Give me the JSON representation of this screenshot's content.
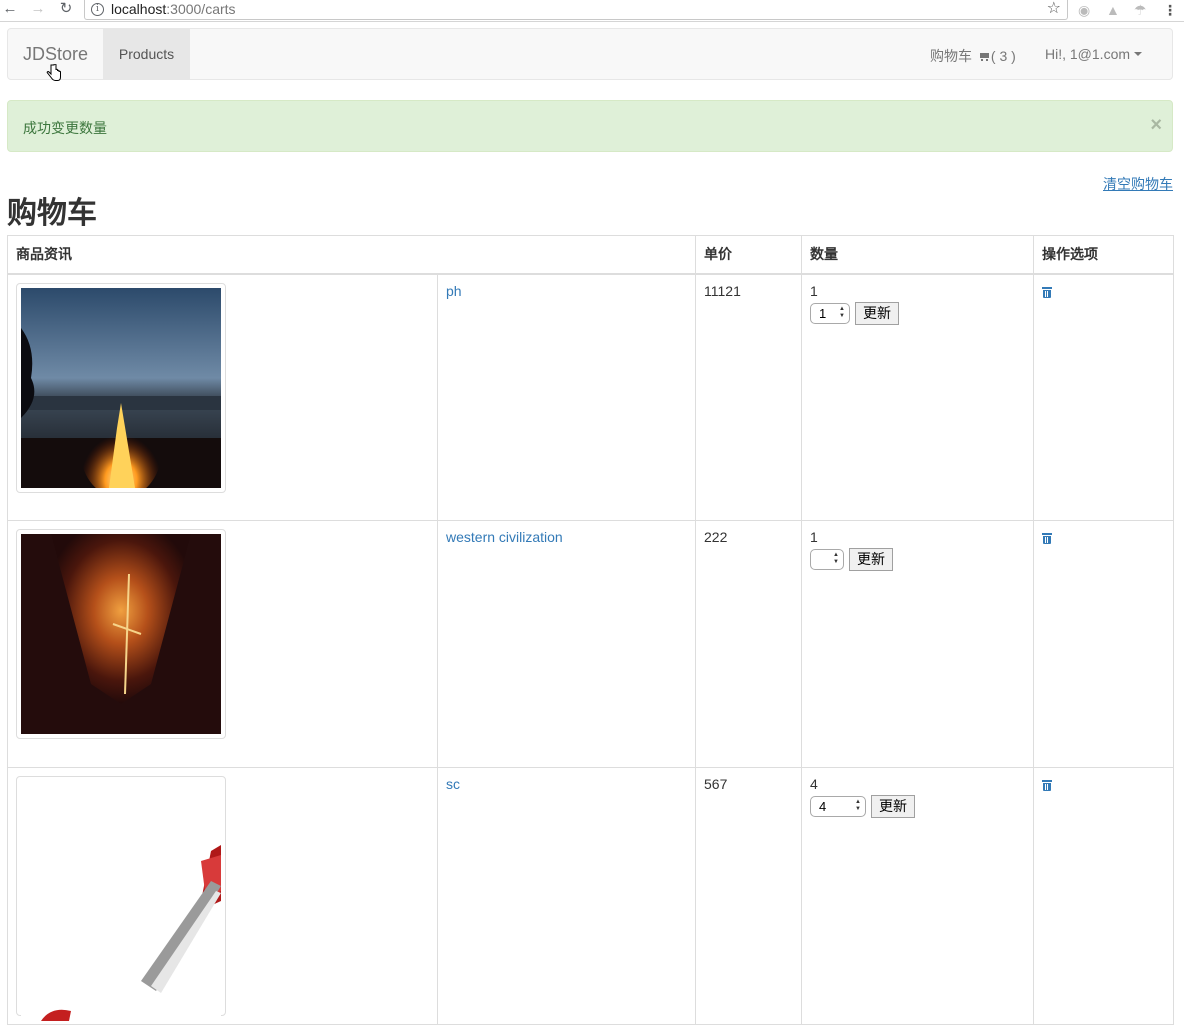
{
  "browser": {
    "url_host": "localhost",
    "url_rest": ":3000/carts"
  },
  "navbar": {
    "brand": "JDStore",
    "products": "Products",
    "cart_label": "购物车",
    "cart_count": "( 3 )",
    "user_label": "Hi!, 1@1.com"
  },
  "alert": {
    "message": "成功变更数量",
    "close": "×"
  },
  "clear_cart": "清空购物车",
  "page_title": "购物车",
  "table": {
    "headers": [
      "商品资讯",
      "单价",
      "数量",
      "操作选项"
    ],
    "rows": [
      {
        "name": "ph",
        "price": "11121",
        "quantity": "1",
        "select_value": "1",
        "update_label": "更新",
        "image": "campfire-lake"
      },
      {
        "name": "western civilization",
        "price": "222",
        "quantity": "1",
        "select_value": "",
        "update_label": "更新",
        "image": "fire-figure"
      },
      {
        "name": "sc",
        "price": "567",
        "quantity": "4",
        "select_value": "4",
        "update_label": "更新",
        "image": "red-product"
      }
    ]
  },
  "colors": {
    "link": "#337ab7",
    "alert_bg": "#dff0d8",
    "alert_text": "#3c763d"
  }
}
